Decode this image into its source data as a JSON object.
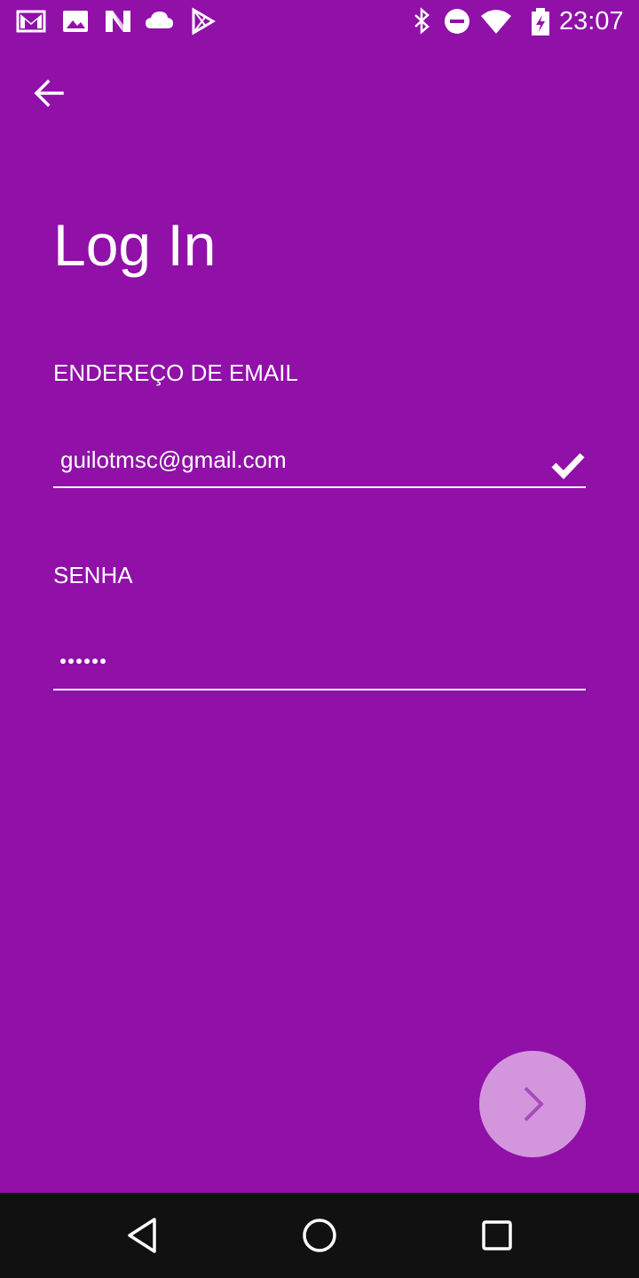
{
  "status_bar": {
    "time": "23:07",
    "left_icons": [
      "gmail-icon",
      "gallery-icon",
      "n-app-icon",
      "cloud-icon",
      "play-store-icon"
    ],
    "right_icons": [
      "bluetooth-icon",
      "do-not-disturb-icon",
      "wifi-icon",
      "battery-charging-icon"
    ]
  },
  "header": {
    "back_icon": "arrow-back-icon"
  },
  "login": {
    "title": "Log In",
    "email_label": "ENDEREÇO DE EMAIL",
    "email_value": "guilotmsc@gmail.com",
    "email_valid_icon": "check-icon",
    "password_label": "SENHA",
    "password_length": 6
  },
  "next_button": {
    "icon": "chevron-right-icon"
  },
  "nav_bar": {
    "back_icon": "nav-back-icon",
    "home_icon": "nav-home-icon",
    "recents_icon": "nav-recents-icon"
  },
  "colors": {
    "background": "#9010a8",
    "fab": "#d396dd",
    "fab_icon": "#a84cbb",
    "nav_bar": "#111111",
    "text": "#ffffff"
  }
}
